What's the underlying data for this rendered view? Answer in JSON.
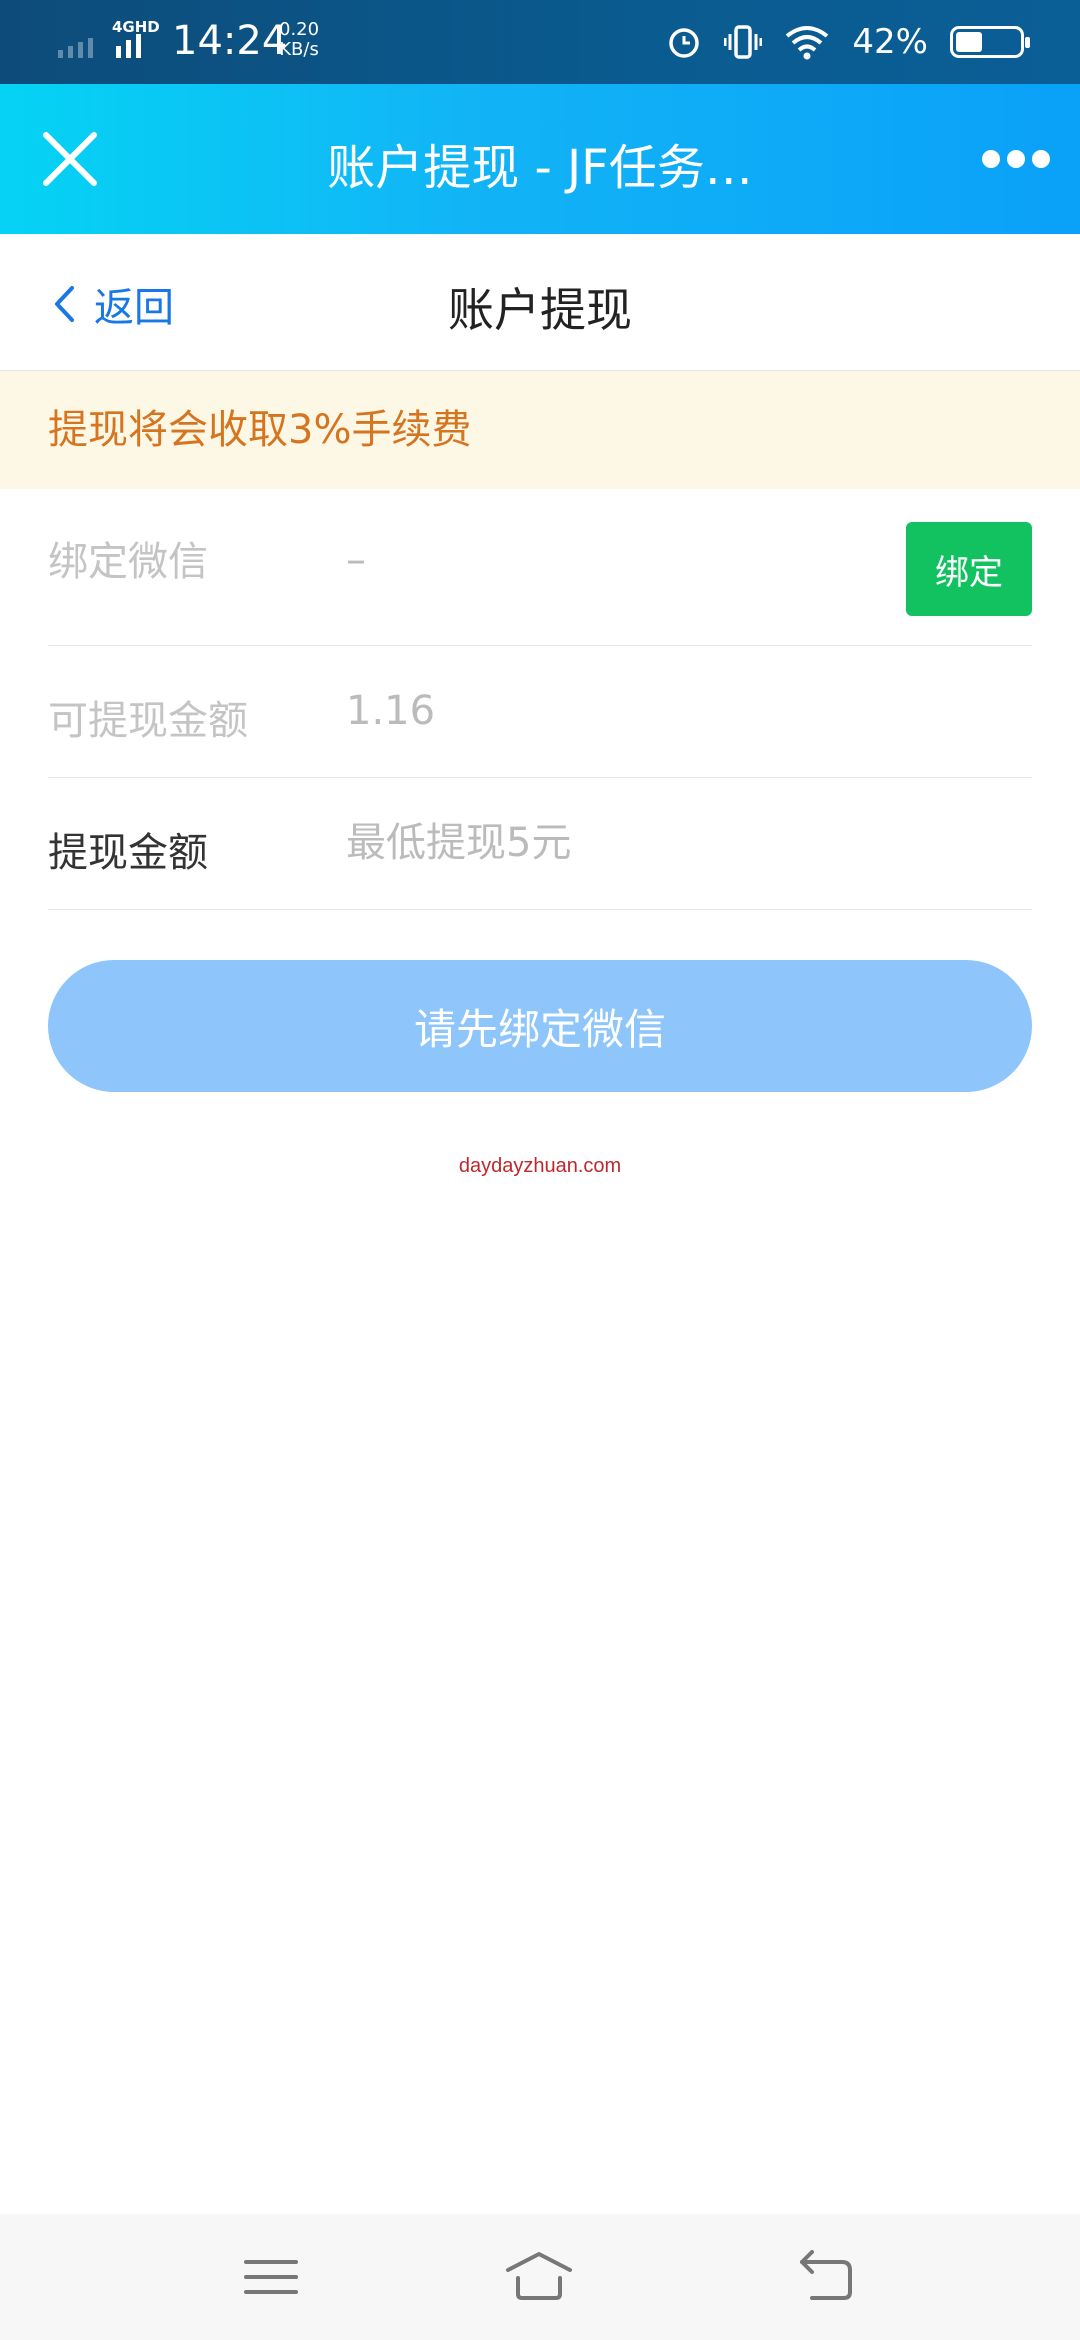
{
  "status_bar": {
    "network_type": "4GHD",
    "time": "14:24",
    "speed_value": "0.20",
    "speed_unit": "KB/s",
    "battery_percent": "42%",
    "battery_level": 0.42
  },
  "app_header": {
    "title": "账户提现 - JF任务…",
    "close_icon": "close-icon",
    "more_icon": "more-icon"
  },
  "nav": {
    "back_label": "返回",
    "title": "账户提现"
  },
  "notice": {
    "text": "提现将会收取3%手续费"
  },
  "form": {
    "wechat_label": "绑定微信",
    "wechat_value": "–",
    "bind_button": "绑定",
    "available_label": "可提现金额",
    "available_value": "1.16",
    "amount_label": "提现金额",
    "amount_placeholder": "最低提现5元"
  },
  "submit_button": "请先绑定微信",
  "watermark": "daydayzhuan.com",
  "colors": {
    "header_gradient_start": "#05d3f4",
    "header_gradient_end": "#0aa1f8",
    "link_blue": "#1a78e6",
    "notice_bg": "#fdf7e6",
    "notice_text": "#d67520",
    "bind_green": "#12c160",
    "submit_blue": "#8ec5fa"
  }
}
